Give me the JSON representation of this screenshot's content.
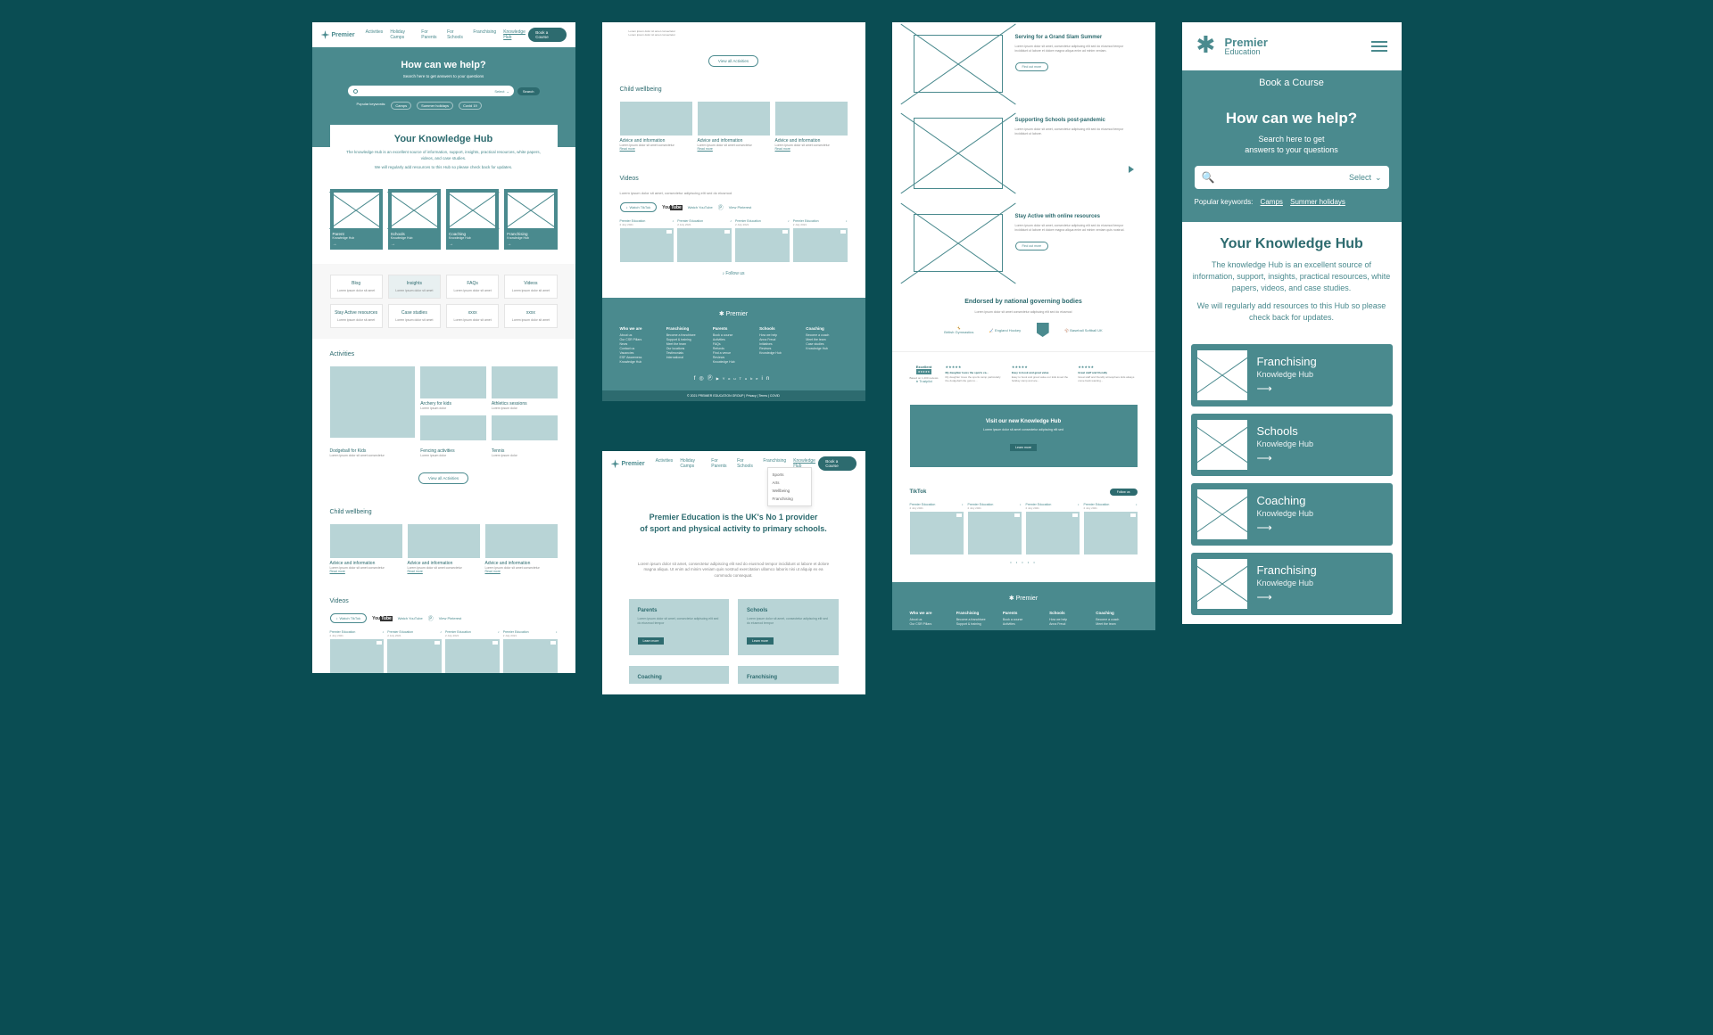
{
  "brand": {
    "name": "Premier",
    "subtitle": "Education"
  },
  "nav": [
    "Activities",
    "Holiday Camps",
    "For Parents",
    "For Schools",
    "Franchising",
    "Knowledge Hub"
  ],
  "book_btn": "Book a Course",
  "hero": {
    "title": "How can we help?",
    "sub": "Search here to get answers to your questions",
    "select": "Select",
    "search_btn": "Search",
    "kw_label": "Popular keywords:",
    "kws": [
      "Camps",
      "Summer holidays",
      "Covid 19"
    ]
  },
  "khub": {
    "title": "Your Knowledge Hub",
    "p1": "The knowledge Hub is an excellent source of information, support, insights, practical resources, white papers, videos, and case studies.",
    "p2": "We will regularly add resources to this Hub so please check back for updates."
  },
  "hub_cards": [
    {
      "title": "Parent",
      "sub": "Knowledge Hub"
    },
    {
      "title": "Schools",
      "sub": "Knowledge Hub"
    },
    {
      "title": "Coaching",
      "sub": "Knowledge Hub"
    },
    {
      "title": "Franchising",
      "sub": "Knowledge Hub"
    }
  ],
  "tiles": [
    {
      "title": "Blog",
      "sub": "Lorem ipsum dolor sit amet"
    },
    {
      "title": "Insights",
      "sub": "Lorem ipsum dolor sit amet"
    },
    {
      "title": "FAQs",
      "sub": "Lorem ipsum dolor sit amet"
    },
    {
      "title": "Videos",
      "sub": "Lorem ipsum dolor sit amet"
    },
    {
      "title": "Stay Active resources",
      "sub": "Lorem ipsum dolor sit amet"
    },
    {
      "title": "Case studies",
      "sub": "Lorem ipsum dolor sit amet"
    },
    {
      "title": "xxxx",
      "sub": "Lorem ipsum dolor sit amet"
    },
    {
      "title": "xxxx",
      "sub": "Lorem ipsum dolor sit amet"
    }
  ],
  "activities": {
    "title": "Activities",
    "items": [
      {
        "title": "Dodgeball for Kids",
        "sub": "Lorem ipsum dolor sit amet consectetur"
      },
      {
        "title": "Archery for kids",
        "sub": "Lorem ipsum dolor"
      },
      {
        "title": "Athletics sessions",
        "sub": "Lorem ipsum dolor"
      },
      {
        "title": "Fencing activities",
        "sub": "Lorem ipsum dolor"
      },
      {
        "title": "Tennis",
        "sub": "Lorem ipsum dolor"
      }
    ],
    "view_all": "View all Activities"
  },
  "cw": {
    "title": "Child wellbeing",
    "items": [
      {
        "title": "Advice and information",
        "sub": "Lorem ipsum dolor sit amet consectetur",
        "link": "Read more"
      },
      {
        "title": "Advice and information",
        "sub": "Lorem ipsum dolor sit amet consectetur",
        "link": "Read more"
      },
      {
        "title": "Advice and information",
        "sub": "Lorem ipsum dolor sit amet consectetur",
        "link": "Read more"
      }
    ]
  },
  "videos": {
    "title": "Videos",
    "sub": "Lorem ipsum dolor sit amet, consectetur adipiscing elit sed do eiusmod",
    "social": {
      "tiktok": "Watch TikTok",
      "youtube": "Watch YouTube",
      "pinterest": "View Pinterest"
    },
    "items": [
      {
        "title": "Premier Education",
        "date": "2 July 2021"
      },
      {
        "title": "Premier Education",
        "date": "2 July 2021"
      },
      {
        "title": "Premier Education",
        "date": "2 July 2021"
      },
      {
        "title": "Premier Education",
        "date": "2 July 2021"
      }
    ],
    "follow": "Follow us"
  },
  "footer": {
    "cols": [
      {
        "h": "Who we are",
        "items": [
          "About us",
          "Our CSR Pillars",
          "News",
          "Contact us",
          "Vacancies",
          "ESF Awareness",
          "Knowledge Hub"
        ]
      },
      {
        "h": "Franchising",
        "items": [
          "Become a franchisee",
          "Support & training",
          "Meet the team",
          "Our locations",
          "Testimonials",
          "International"
        ]
      },
      {
        "h": "Parents",
        "items": [
          "Book a course",
          "Activities",
          "FAQs",
          "Refunds",
          "Find a venue",
          "Reviews",
          "Knowledge Hub"
        ]
      },
      {
        "h": "Schools",
        "items": [
          "How we help",
          "Anna Freud",
          "Initiatives",
          "Reviews",
          "Knowledge Hub"
        ]
      },
      {
        "h": "Coaching",
        "items": [
          "Become a coach",
          "Meet the team",
          "Case studies",
          "Knowledge Hub"
        ]
      }
    ],
    "copyright": "© 2021 PREMIER EDUCATION GROUP | Privacy | Terms | COVID"
  },
  "f2b": {
    "dropdown": [
      "Sports",
      "Arts",
      "Wellbeing",
      "Franchising"
    ],
    "hero1": "Premier Education is the UK's No 1 provider",
    "hero2": "of sport and physical activity to primary schools.",
    "intro": "Lorem ipsum dolor sit amet, consectetur adipiscing elit sed do eiusmod tempor incididunt ut labore et dolore magna aliqua. Ut enim ad minim veniam quis nostrud exercitation ullamco laboris nisi ut aliquip ex ea commodo consequat.",
    "cards": [
      {
        "title": "Parents",
        "text": "Lorem ipsum dolor sit amet, consectetur adipiscing elit sed do eiusmod tempor",
        "btn": "Learn more"
      },
      {
        "title": "Schools",
        "text": "Lorem ipsum dolor sit amet, consectetur adipiscing elit sed do eiusmod tempor",
        "btn": "Learn more"
      },
      {
        "title": "Coaching",
        "text": ""
      },
      {
        "title": "Franchising",
        "text": ""
      }
    ]
  },
  "f3": {
    "stories": [
      {
        "title": "Serving for a Grand Slam Summer",
        "text": "Lorem ipsum dolor sit amet, consectetur adipiscing elit sed do eiusmod tempor incididunt ut labore et dolore magna aliqua enim ad minim veniam.",
        "btn": "Find out more"
      },
      {
        "title": "Supporting Schools post-pandemic",
        "text": "Lorem ipsum dolor sit amet, consectetur adipiscing elit sed do eiusmod tempor incididunt ut labore.",
        "btn": ""
      },
      {
        "title": "Stay Active with online resources",
        "text": "Lorem ipsum dolor sit amet, consectetur adipiscing elit sed do eiusmod tempor incididunt ut labore et dolore magna aliqua enim ad minim veniam quis nostrud.",
        "btn": "Find out more"
      }
    ],
    "endorsed": {
      "title": "Endorsed by national governing bodies",
      "sub": "Lorem ipsum dolor sit amet consectetur adipiscing elit sed do eiusmod",
      "logos": [
        "British Gymnastics",
        "England Hockey",
        "",
        "Baseball Softball UK"
      ]
    },
    "trust": {
      "label": "Excellent",
      "sub": "Based on 1,200 reviews",
      "pilot": "Trustpilot",
      "reviews": [
        {
          "title": "My daughter loves the sports ca...",
          "text": "My daughter loves the sports camp particularly the dodgeball she gets to..."
        },
        {
          "title": "Easy to book and great value",
          "text": "Easy to book and great value our kids loved the holiday camp and are..."
        },
        {
          "title": "Great staff and friendly",
          "text": "Great staff and friendly atmosphere kids always come back wanting..."
        }
      ]
    },
    "cta": {
      "title": "Visit our new Knowledge Hub",
      "text": "Lorem ipsum dolor sit amet consectetur adipiscing elit sed",
      "btn": "Learn more"
    },
    "tiktok": {
      "title": "TikTok",
      "follow": "Follow us"
    }
  },
  "f4": {
    "hero_sub": "Search here to get\nanswers to your questions",
    "kws": [
      "Camps",
      "Summer holidays"
    ],
    "cards": [
      {
        "title": "Franchising",
        "sub": "Knowledge Hub"
      },
      {
        "title": "Schools",
        "sub": "Knowledge Hub"
      },
      {
        "title": "Coaching",
        "sub": "Knowledge Hub"
      },
      {
        "title": "Franchising",
        "sub": "Knowledge Hub"
      }
    ]
  }
}
